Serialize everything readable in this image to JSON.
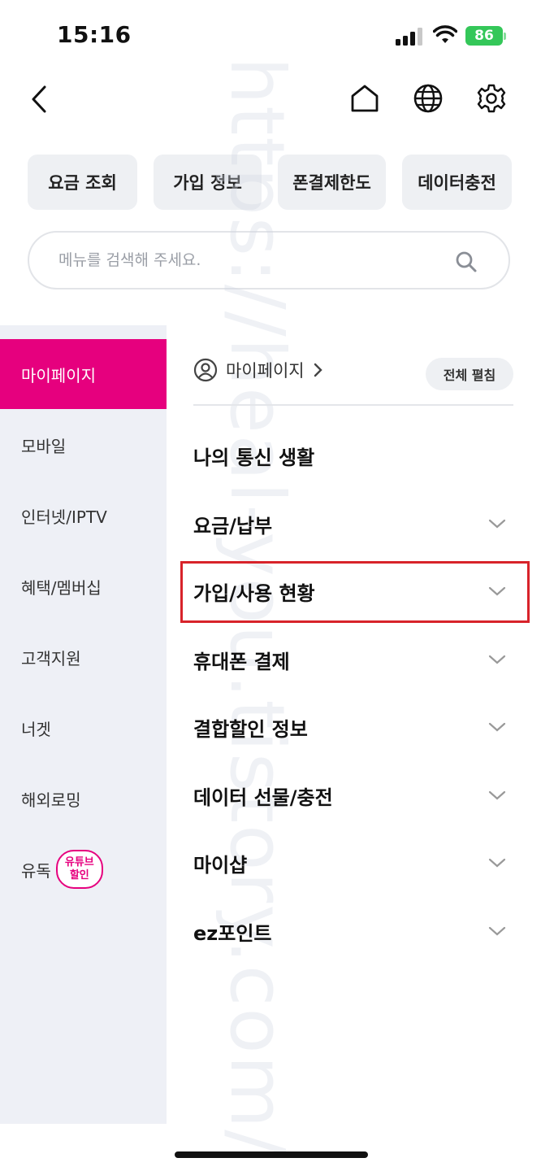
{
  "status_bar": {
    "time": "15:16",
    "battery": "86"
  },
  "quick_buttons": [
    "요금 조회",
    "가입 정보",
    "폰결제한도",
    "데이터충전"
  ],
  "search": {
    "placeholder": "메뉴를 검색해 주세요."
  },
  "sidebar": {
    "items": [
      {
        "label": "마이페이지",
        "active": true
      },
      {
        "label": "모바일"
      },
      {
        "label": "인터넷/IPTV"
      },
      {
        "label": "혜택/멤버십"
      },
      {
        "label": "고객지원"
      },
      {
        "label": "너겟"
      },
      {
        "label": "해외로밍"
      },
      {
        "label": "유독",
        "badge_line1": "유튜브",
        "badge_line2": "할인"
      }
    ]
  },
  "content": {
    "breadcrumb": "마이페이지",
    "expand_all": "전체 펼침",
    "section_title": "나의 통신 생활",
    "menu": [
      "요금/납부",
      "가입/사용 현황",
      "휴대폰 결제",
      "결합할인 정보",
      "데이터 선물/충전",
      "마이샵",
      "ez포인트"
    ]
  },
  "watermark": "https://heal-you.tistory.com/",
  "colors": {
    "accent": "#e6007e",
    "highlight": "#d8232a",
    "battery": "#34c759"
  }
}
